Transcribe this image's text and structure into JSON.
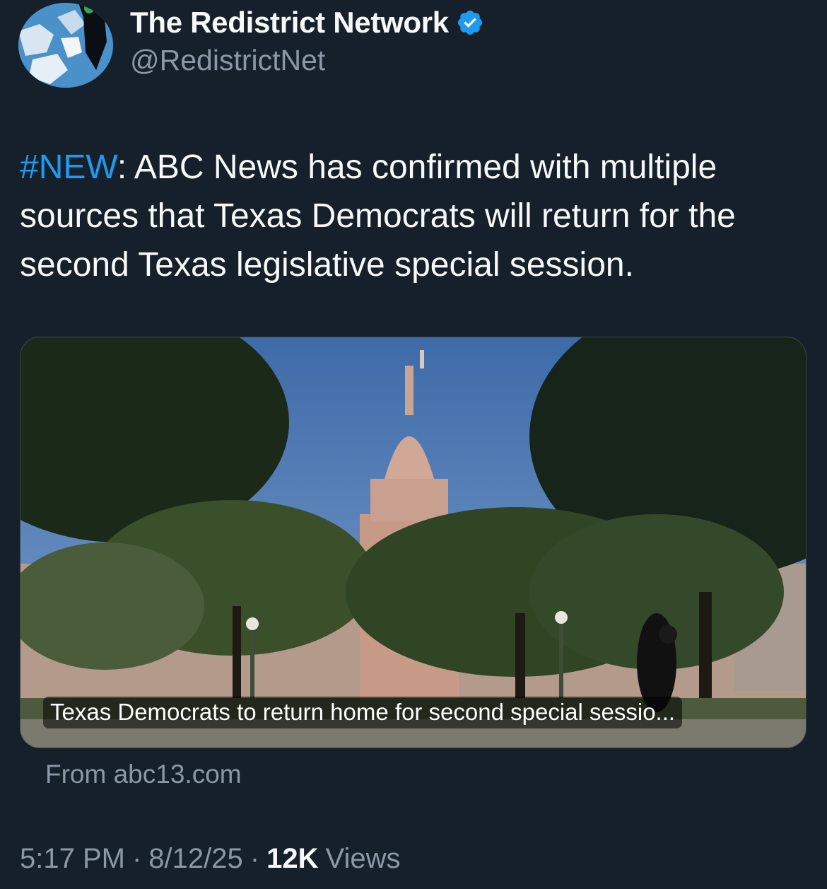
{
  "author": {
    "display_name": "The Redistrict Network",
    "handle": "@RedistrictNet",
    "verified": true,
    "avatar_icon": "puzzle-map-avatar"
  },
  "tweet": {
    "hashtag": "#NEW",
    "text": ": ABC News has confirmed with multiple sources that Texas Democrats will return for the second Texas legislative special session."
  },
  "link_card": {
    "image_icon": "texas-capitol-photo",
    "title": "Texas Democrats to return home for second special sessio...",
    "source": "From abc13.com"
  },
  "meta": {
    "time": "5:17 PM",
    "separator": "·",
    "date": "8/12/25",
    "views_count": "12K",
    "views_label": "Views"
  },
  "colors": {
    "background": "#15202b",
    "accent": "#1d9bf0",
    "secondary_text": "#8b98a5"
  }
}
